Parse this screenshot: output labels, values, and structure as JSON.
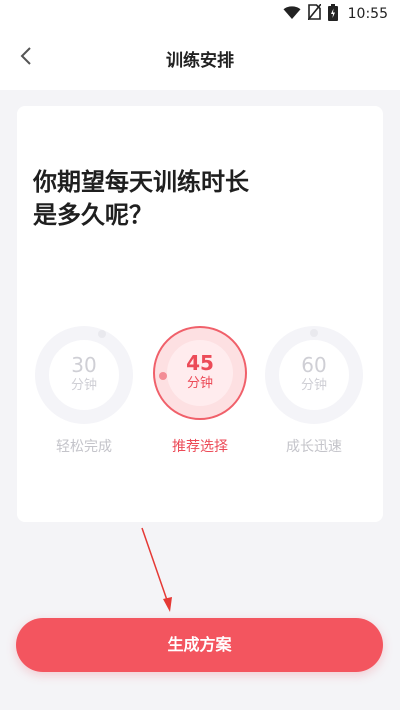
{
  "status_bar": {
    "time": "10:55",
    "icons": [
      "wifi-icon",
      "no-sim-icon",
      "battery-icon"
    ]
  },
  "header": {
    "back_icon": "chevron-left-icon",
    "title": "训练安排"
  },
  "question": {
    "line1": "你期望每天训练时长",
    "line2": "是多久呢？"
  },
  "options": [
    {
      "value": "30",
      "unit": "分钟",
      "label": "轻松完成",
      "selected": false
    },
    {
      "value": "45",
      "unit": "分钟",
      "label": "推荐选择",
      "selected": true
    },
    {
      "value": "60",
      "unit": "分钟",
      "label": "成长迅速",
      "selected": false
    }
  ],
  "actions": {
    "generate_label": "生成方案"
  },
  "colors": {
    "accent": "#f3555f",
    "selected_text": "#ec4b58",
    "annotation_arrow": "#e53935"
  }
}
